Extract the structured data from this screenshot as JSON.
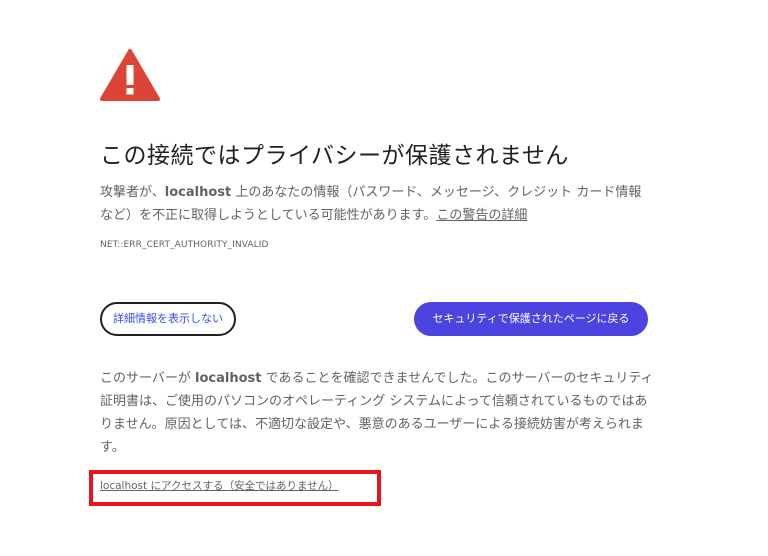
{
  "warning": {
    "icon": "warning-triangle-icon",
    "color": "#db4437"
  },
  "title": "この接続ではプライバシーが保護されません",
  "description": {
    "prefix": "攻撃者が、",
    "host": "localhost",
    "middle": " 上のあなたの情報（パスワード、メッセージ、クレジット カード情報など）を不正に取得しようとしている可能性があります。",
    "link": "この警告の詳細"
  },
  "error_code": "NET::ERR_CERT_AUTHORITY_INVALID",
  "buttons": {
    "details_label": "詳細情報を表示しない",
    "back_label": "セキュリティで保護されたページに戻る",
    "back_color": "#4c44e0"
  },
  "explanation": {
    "prefix": "このサーバーが ",
    "host": "localhost",
    "suffix": " であることを確認できませんでした。このサーバーのセキュリティ証明書は、ご使用のパソコンのオペレーティング システムによって信頼されているものではありません。原因としては、不適切な設定や、悪意のあるユーザーによる接続妨害が考えられます。"
  },
  "proceed_link": "localhost にアクセスする（安全ではありません）",
  "highlight_color": "#e8141b"
}
